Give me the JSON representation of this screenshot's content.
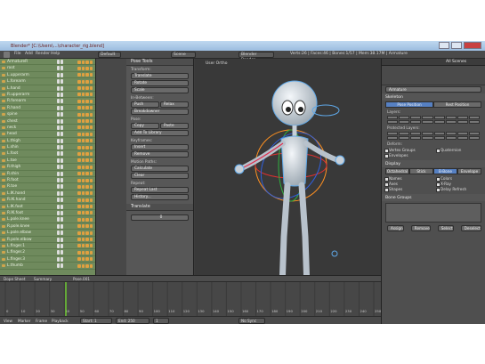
{
  "window": {
    "title": "Blender* [C:\\Users\\...\\character_rig.blend]"
  },
  "menu": {
    "items": [
      "File",
      "Add",
      "Render",
      "Help"
    ],
    "editor_label": "Default",
    "scene": "Scene",
    "engine": "Blender Render",
    "stats": "Verts:26 | Faces:46 | Bones:1/57 | Mem:38.17M | Armature"
  },
  "outliner": {
    "rows": [
      "ArmatureR",
      "root",
      "L.upperarm",
      "L.forearm",
      "L.hand",
      "R.upperarm",
      "R.forearm",
      "R.hand",
      "spine",
      "chest",
      "neck",
      "head",
      "L.thigh",
      "L.shin",
      "L.foot",
      "L.toe",
      "R.thigh",
      "R.shin",
      "R.foot",
      "R.toe",
      "L.IK.hand",
      "R.IK.hand",
      "L.IK.foot",
      "R.IK.foot",
      "L.pole.knee",
      "R.pole.knee",
      "L.pole.elbow",
      "R.pole.elbow",
      "L.finger.1",
      "L.finger.2",
      "L.finger.3",
      "L.thumb"
    ]
  },
  "tools": {
    "header": "Pose Tools",
    "transform_label": "Transform:",
    "transform_buttons": [
      "Translate",
      "Rotate",
      "Scale"
    ],
    "in_between_label": "In-Between:",
    "in_between_buttons": [
      "Push",
      "Relax",
      "Breakdowner"
    ],
    "pose_label": "Pose:",
    "pose_buttons": [
      "Copy",
      "Paste"
    ],
    "library_button": "Add To Library",
    "keyframes_label": "Keyframes:",
    "keyframe_buttons": [
      "Insert",
      "Remove"
    ],
    "motion_paths_label": "Motion Paths:",
    "motion_path_buttons": [
      "Calculate",
      "Clear"
    ],
    "repeat_label": "Repeat:",
    "repeat_buttons": [
      "Repeat Last",
      "History..."
    ],
    "panel2_header": "Translate",
    "panel2_value": "0"
  },
  "viewport": {
    "label": "User Ortho",
    "status": "(1) Armature : upper_arm.L"
  },
  "properties": {
    "header_search": "All Scenes",
    "object_name": "Armature",
    "section_skeleton": "Skeleton",
    "tabs_pose": [
      "Pose Position",
      "Rest Position"
    ],
    "layers_label": "Layers:",
    "protected_label": "Protected Layers:",
    "deform_label": "Deform:",
    "deform_opts": [
      "Vertex Groups",
      "Quaternion",
      "Envelopes"
    ],
    "section_display": "Display",
    "display_tabs": [
      "Octahedral",
      "Stick",
      "B-Bone",
      "Envelope"
    ],
    "display_opts": [
      "Names",
      "Colors",
      "Axes",
      "X-Ray",
      "Shapes",
      "Delay Refresh"
    ],
    "section_bone_groups": "Bone Groups",
    "bone_group_buttons": [
      "Assign",
      "Remove",
      "Select",
      "Deselect"
    ]
  },
  "timeline": {
    "menu": [
      "View",
      "Marker",
      "Frame",
      "Playback"
    ],
    "editor_label": "Dope Sheet",
    "mode": "Action Editor",
    "summary": "Summary",
    "action": "Pose.001",
    "start": "Start: 1",
    "end": "End: 250",
    "current": "1",
    "sync": "No Sync",
    "frame_labels": [
      "0",
      "10",
      "20",
      "30",
      "40",
      "50",
      "60",
      "70",
      "80",
      "90",
      "100",
      "110",
      "120",
      "130",
      "140",
      "150",
      "160",
      "170",
      "180",
      "190",
      "200",
      "210",
      "220",
      "230",
      "240",
      "250"
    ]
  },
  "colors": {
    "accent": "#5680c2",
    "outliner_bg": "#6f8a5d",
    "selection": "#ffa030"
  }
}
